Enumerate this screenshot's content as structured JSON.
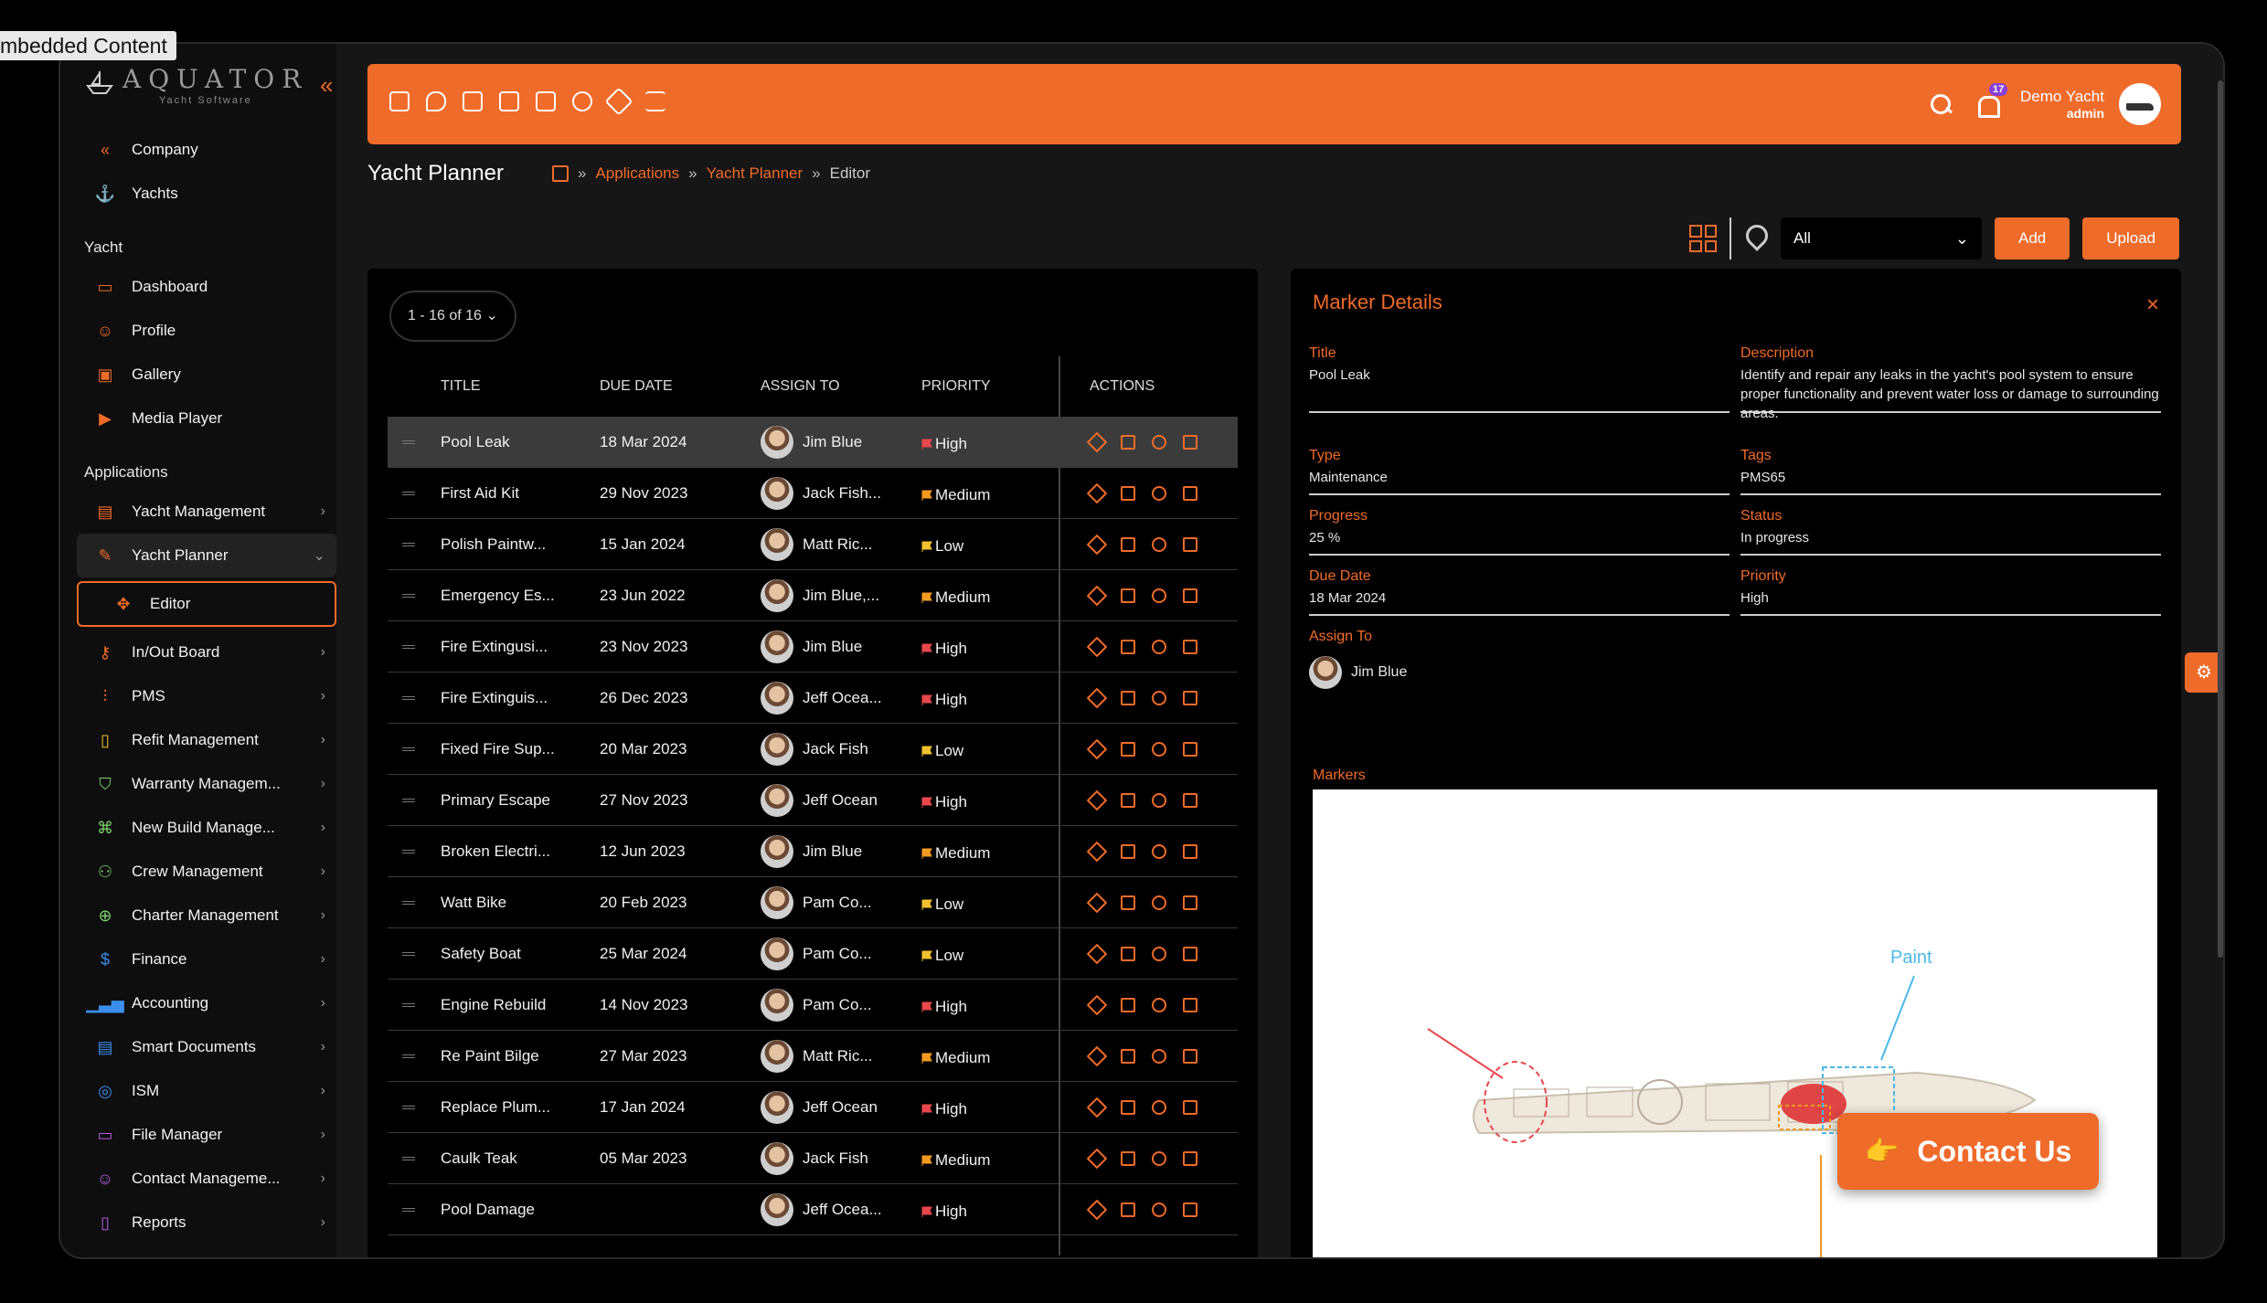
{
  "overlay_label": "mbedded Content",
  "brand": {
    "name": "AQUATOR",
    "tagline": "Yacht Software",
    "collapse_icon": "double-chevron-left-icon"
  },
  "sidebar": {
    "top_items": [
      {
        "label": "Company",
        "icon": "double-chevron-left-icon"
      },
      {
        "label": "Yachts",
        "icon": "anchor-icon"
      }
    ],
    "section_yacht": "Yacht",
    "yacht_items": [
      {
        "label": "Dashboard",
        "icon": "monitor-icon"
      },
      {
        "label": "Profile",
        "icon": "user-icon"
      },
      {
        "label": "Gallery",
        "icon": "image-icon"
      },
      {
        "label": "Media Player",
        "icon": "video-icon"
      }
    ],
    "section_apps": "Applications",
    "app_items": [
      {
        "label": "Yacht Management",
        "icon": "briefcase-icon"
      },
      {
        "label": "Yacht Planner",
        "icon": "pencil-icon"
      },
      {
        "label": "Editor",
        "icon": "move-icon"
      },
      {
        "label": "In/Out Board",
        "icon": "key-icon"
      },
      {
        "label": "PMS",
        "icon": "sliders-icon"
      },
      {
        "label": "Refit Management",
        "icon": "clipboard-icon"
      },
      {
        "label": "Warranty Managem...",
        "icon": "shield-check-icon"
      },
      {
        "label": "New Build Manage...",
        "icon": "command-icon"
      },
      {
        "label": "Crew Management",
        "icon": "users-icon"
      },
      {
        "label": "Charter Management",
        "icon": "globe-icon"
      },
      {
        "label": "Finance",
        "icon": "dollar-icon"
      },
      {
        "label": "Accounting",
        "icon": "bar-chart-icon"
      },
      {
        "label": "Smart Documents",
        "icon": "document-icon"
      },
      {
        "label": "ISM",
        "icon": "lifebuoy-icon"
      },
      {
        "label": "File Manager",
        "icon": "folder-icon"
      },
      {
        "label": "Contact Manageme...",
        "icon": "user-plus-icon"
      },
      {
        "label": "Reports",
        "icon": "report-icon"
      }
    ]
  },
  "topbar": {
    "notifications_count": "17",
    "user_name": "Demo Yacht",
    "user_role": "admin"
  },
  "page": {
    "title": "Yacht Planner",
    "breadcrumb": [
      "Applications",
      "Yacht Planner",
      "Editor"
    ]
  },
  "toolbar": {
    "filter_value": "All",
    "add_label": "Add",
    "upload_label": "Upload"
  },
  "table": {
    "pager": "1 - 16 of 16",
    "headers": {
      "title": "TITLE",
      "due": "DUE DATE",
      "assign": "ASSIGN TO",
      "priority": "PRIORITY",
      "actions": "ACTIONS"
    },
    "rows": [
      {
        "title": "Pool Leak",
        "due": "18 Mar 2024",
        "assign": "Jim Blue",
        "priority": "High"
      },
      {
        "title": "First Aid Kit",
        "due": "29 Nov 2023",
        "assign": "Jack Fish...",
        "priority": "Medium"
      },
      {
        "title": "Polish Paintw...",
        "due": "15 Jan 2024",
        "assign": "Matt Ric...",
        "priority": "Low"
      },
      {
        "title": "Emergency Es...",
        "due": "23 Jun 2022",
        "assign": "Jim Blue,...",
        "priority": "Medium"
      },
      {
        "title": "Fire Extingusi...",
        "due": "23 Nov 2023",
        "assign": "Jim Blue",
        "priority": "High"
      },
      {
        "title": "Fire Extinguis...",
        "due": "26 Dec 2023",
        "assign": "Jeff Ocea...",
        "priority": "High"
      },
      {
        "title": "Fixed Fire Sup...",
        "due": "20 Mar 2023",
        "assign": "Jack Fish",
        "priority": "Low"
      },
      {
        "title": "Primary Escape",
        "due": "27 Nov 2023",
        "assign": "Jeff Ocean",
        "priority": "High"
      },
      {
        "title": "Broken Electri...",
        "due": "12 Jun 2023",
        "assign": "Jim Blue",
        "priority": "Medium"
      },
      {
        "title": "Watt Bike",
        "due": "20 Feb 2023",
        "assign": "Pam Co...",
        "priority": "Low"
      },
      {
        "title": "Safety Boat",
        "due": "25 Mar 2024",
        "assign": "Pam Co...",
        "priority": "Low"
      },
      {
        "title": "Engine Rebuild",
        "due": "14 Nov 2023",
        "assign": "Pam Co...",
        "priority": "High"
      },
      {
        "title": "Re Paint Bilge",
        "due": "27 Mar 2023",
        "assign": "Matt Ric...",
        "priority": "Medium"
      },
      {
        "title": "Replace Plum...",
        "due": "17 Jan 2024",
        "assign": "Jeff Ocean",
        "priority": "High"
      },
      {
        "title": "Caulk Teak",
        "due": "05 Mar 2023",
        "assign": "Jack Fish",
        "priority": "Medium"
      },
      {
        "title": "Pool Damage",
        "due": "",
        "assign": "Jeff Ocea...",
        "priority": "High"
      }
    ],
    "priority_colors": {
      "High": "#e8474b",
      "Medium": "#f29a1f",
      "Low": "#f2c12e"
    }
  },
  "details": {
    "heading": "Marker Details",
    "title_label": "Title",
    "title_value": "Pool Leak",
    "description_label": "Description",
    "description_value": "Identify and repair any leaks in the yacht's pool system to ensure proper functionality and prevent water loss or damage to surrounding areas.",
    "type_label": "Type",
    "type_value": "Maintenance",
    "tags_label": "Tags",
    "tags_value": "PMS65",
    "progress_label": "Progress",
    "progress_value": "25 %",
    "status_label": "Status",
    "status_value": "In progress",
    "due_label": "Due Date",
    "due_value": "18 Mar 2024",
    "priority_label": "Priority",
    "priority_value": "High",
    "assign_label": "Assign To",
    "assign_value": "Jim Blue",
    "markers_label": "Markers",
    "paint_label": "Paint"
  },
  "contact": {
    "label": "Contact Us"
  },
  "colors": {
    "accent": "#ef6b2a",
    "panel": "#000000",
    "frame": "#161616"
  }
}
